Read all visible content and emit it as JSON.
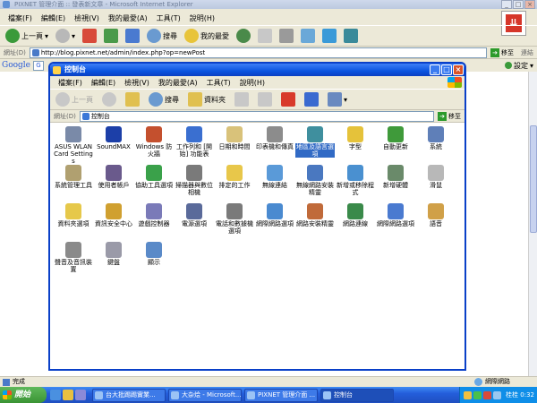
{
  "ie": {
    "title": "PIXNET 管理介面 :: 發表新文章 - Microsoft Internet Explorer",
    "menu": [
      "檔案(F)",
      "編輯(E)",
      "檢視(V)",
      "我的最愛(A)",
      "工具(T)",
      "說明(H)"
    ],
    "toolbar": {
      "back": "上一頁",
      "search": "搜尋",
      "favorites": "我的最愛"
    },
    "address_label": "網址(D)",
    "url": "http://blog.pixnet.net/admin/index.php?op=newPost",
    "go": "移至",
    "links": "連結",
    "google": {
      "logo": "Google",
      "box": "G",
      "settings": "設定"
    },
    "status_left": "完成",
    "status_right": "網際網路"
  },
  "cp": {
    "title": "控制台",
    "menu": [
      "檔案(F)",
      "編輯(E)",
      "檢視(V)",
      "我的最愛(A)",
      "工具(T)",
      "說明(H)"
    ],
    "toolbar": {
      "back": "上一頁",
      "search": "搜尋",
      "folders": "資料夾"
    },
    "address_label": "網址(D)",
    "address": "控制台",
    "go": "移至",
    "items": [
      {
        "label": "ASUS WLAN Card Settings",
        "color": "#7a8aa8",
        "name": "asus-wlan-icon"
      },
      {
        "label": "SoundMAX",
        "color": "#1c3fa8",
        "name": "soundmax-icon"
      },
      {
        "label": "Windows 防火牆",
        "color": "#c4502e",
        "name": "firewall-icon"
      },
      {
        "label": "工作列和 [開始] 功能表",
        "color": "#3a6fd0",
        "name": "taskbar-icon"
      },
      {
        "label": "日期和時間",
        "color": "#d9c27a",
        "name": "clock-icon"
      },
      {
        "label": "印表機和傳真",
        "color": "#8c8c8c",
        "name": "printer-icon"
      },
      {
        "label": "地區及語言選項",
        "color": "#3f8f9e",
        "name": "globe-icon"
      },
      {
        "label": "字型",
        "color": "#e5c23a",
        "name": "fonts-icon"
      },
      {
        "label": "自動更新",
        "color": "#3f9a3a",
        "name": "update-icon"
      },
      {
        "label": "系統",
        "color": "#5f7fb8",
        "name": "system-icon"
      },
      {
        "label": "系統管理工具",
        "color": "#b0a070",
        "name": "admin-tools-icon"
      },
      {
        "label": "使用者帳戶",
        "color": "#6a5a8c",
        "name": "users-icon"
      },
      {
        "label": "協助工具選項",
        "color": "#3aa14a",
        "name": "accessibility-icon"
      },
      {
        "label": "掃描器與數位相機",
        "color": "#7a7a7a",
        "name": "scanner-icon"
      },
      {
        "label": "排定的工作",
        "color": "#e8c74a",
        "name": "tasks-icon"
      },
      {
        "label": "無線連結",
        "color": "#5a9ad8",
        "name": "wireless-link-icon"
      },
      {
        "label": "無線網路安裝精靈",
        "color": "#4a78c0",
        "name": "wireless-wizard-icon"
      },
      {
        "label": "新增或移除程式",
        "color": "#4a90d0",
        "name": "add-remove-icon"
      },
      {
        "label": "新增硬體",
        "color": "#6a8a6a",
        "name": "hardware-icon"
      },
      {
        "label": "滑鼠",
        "color": "#b8b8b8",
        "name": "mouse-icon"
      },
      {
        "label": "資料夾選項",
        "color": "#e6c84a",
        "name": "folder-options-icon"
      },
      {
        "label": "資訊安全中心",
        "color": "#d0a030",
        "name": "security-center-icon"
      },
      {
        "label": "遊戲控制器",
        "color": "#7a7ab8",
        "name": "game-icon"
      },
      {
        "label": "電源選項",
        "color": "#5a6a9a",
        "name": "power-icon"
      },
      {
        "label": "電話和數據機選項",
        "color": "#7a7a7a",
        "name": "phone-icon"
      },
      {
        "label": "網際網路選項",
        "color": "#4a8ad0",
        "name": "internet-options-icon"
      },
      {
        "label": "網路安裝精靈",
        "color": "#c06a3a",
        "name": "network-wizard-icon"
      },
      {
        "label": "網路連線",
        "color": "#3a8a4a",
        "name": "network-connections-icon"
      },
      {
        "label": "網際網路選項",
        "color": "#4a7ad0",
        "name": "internet-icon"
      },
      {
        "label": "語音",
        "color": "#d0a048",
        "name": "speech-icon"
      },
      {
        "label": "聲音及音訊裝置",
        "color": "#8a8a8a",
        "name": "sound-icon"
      },
      {
        "label": "鍵盤",
        "color": "#9a9aa8",
        "name": "keyboard-icon"
      },
      {
        "label": "顯示",
        "color": "#5a8ac8",
        "name": "display-icon"
      }
    ]
  },
  "taskbar": {
    "start": "開始",
    "tasks": [
      "台大批踢踢實業...",
      "大杂烩 - Microsoft...",
      "PIXNET 管理介面 ...",
      "控制台"
    ],
    "clock": "桂桂 0:32"
  }
}
